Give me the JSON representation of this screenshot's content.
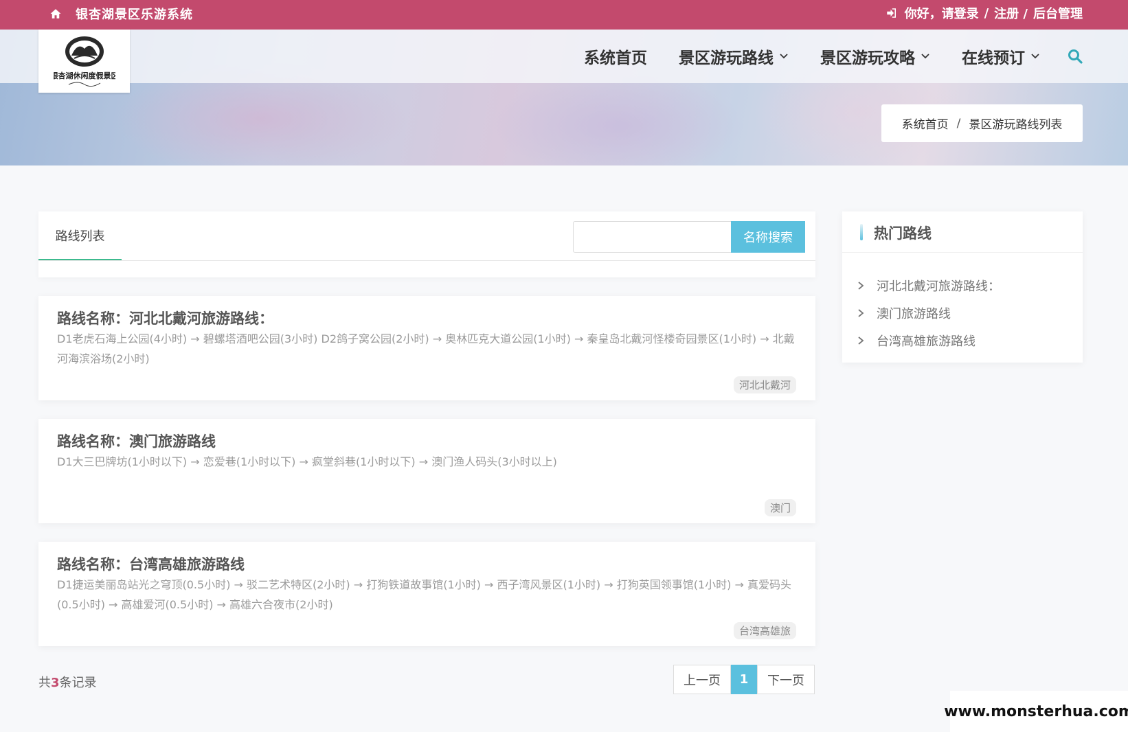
{
  "topbar": {
    "site_title": "银杏湖景区乐游系统",
    "greeting": "你好，请登录",
    "sep": "/",
    "register": "注册 /",
    "admin": "后台管理"
  },
  "logo": {
    "text": "银杏湖休闲度假景区"
  },
  "nav": {
    "items": [
      {
        "label": "系统首页"
      },
      {
        "label": "景区游玩路线"
      },
      {
        "label": "景区游玩攻略"
      },
      {
        "label": "在线预订"
      }
    ]
  },
  "breadcrumb": {
    "home": "系统首页",
    "sep": "/",
    "current": "景区游玩路线列表"
  },
  "list": {
    "tab_label": "路线列表",
    "search_placeholder": "",
    "search_button": "名称搜索",
    "routes": [
      {
        "title": "路线名称：河北北戴河旅游路线：",
        "desc": "D1老虎石海上公园(4小时) → 碧螺塔酒吧公园(3小时) D2鸽子窝公园(2小时) → 奥林匹克大道公园(1小时) → 秦皇岛北戴河怪楼奇园景区(1小时) → 北戴河海滨浴场(2小时)",
        "tag": "河北北戴河"
      },
      {
        "title": "路线名称：澳门旅游路线",
        "desc": "D1大三巴牌坊(1小时以下) → 恋爱巷(1小时以下) → 疯堂斜巷(1小时以下) → 澳门渔人码头(3小时以上)",
        "tag": "澳门"
      },
      {
        "title": "路线名称：台湾高雄旅游路线",
        "desc": "D1捷运美丽岛站光之穹顶(0.5小时) → 驳二艺术特区(2小时) → 打狗铁道故事馆(1小时) → 西子湾风景区(1小时) → 打狗英国领事馆(1小时) → 真爱码头(0.5小时) → 高雄爱河(0.5小时) → 高雄六合夜市(2小时)",
        "tag": "台湾高雄旅"
      }
    ],
    "total_prefix": "共",
    "total_count": "3",
    "total_suffix": "条记录"
  },
  "pager": {
    "prev": "上一页",
    "current": "1",
    "next": "下一页"
  },
  "sidebar": {
    "title": "热门路线",
    "items": [
      {
        "label": "河北北戴河旅游路线："
      },
      {
        "label": "澳门旅游路线"
      },
      {
        "label": "台湾高雄旅游路线"
      }
    ]
  },
  "watermark": "www.monsterhua.com",
  "colors": {
    "topbar": "#c34a6d",
    "accent": "#5bc0de",
    "tab_underline": "#3cba8e"
  }
}
